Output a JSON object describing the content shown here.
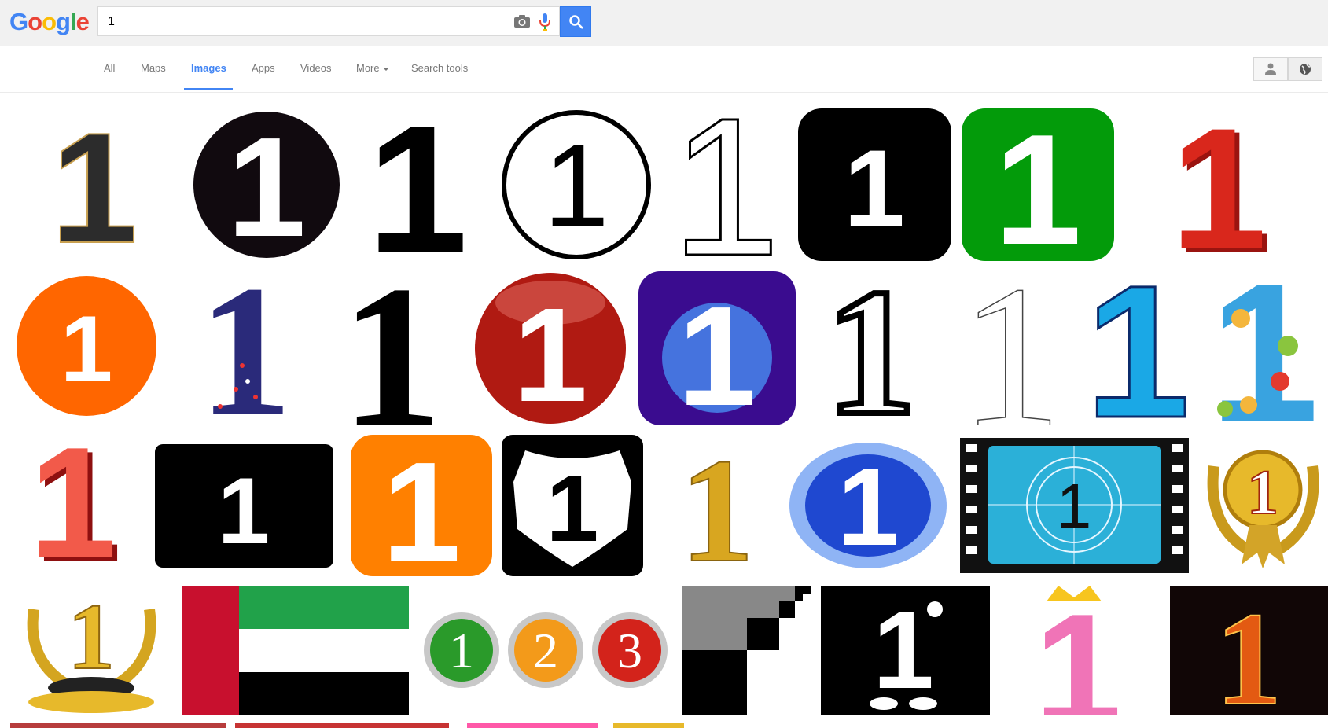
{
  "logo": {
    "letters": [
      "G",
      "o",
      "o",
      "g",
      "l",
      "e"
    ],
    "colors": [
      "#4285f4",
      "#ea4335",
      "#fbbc05",
      "#4285f4",
      "#34a853",
      "#ea4335"
    ]
  },
  "search": {
    "query": "1"
  },
  "tabs": [
    {
      "label": "All",
      "active": false
    },
    {
      "label": "Maps",
      "active": false
    },
    {
      "label": "Images",
      "active": true
    },
    {
      "label": "Apps",
      "active": false
    },
    {
      "label": "Videos",
      "active": false
    },
    {
      "label": "More",
      "active": false
    },
    {
      "label": "Search tools",
      "active": false
    }
  ],
  "colors": {
    "accent": "#4285f4",
    "topbar_bg": "#f1f1f1"
  },
  "results": {
    "rows": [
      [
        "3d-dark-one",
        "black-circle-one",
        "black-one",
        "circled-one",
        "outline-one",
        "black-rounded-square-one",
        "green-rounded-square-one",
        "red-3d-one"
      ],
      [
        "orange-circle-one",
        "starry-one",
        "serif-one",
        "red-glossy-circle-one",
        "purple-glow-square-one",
        "bold-outline-one",
        "thin-outline-one",
        "blue-one",
        "polka-dot-one"
      ],
      [
        "red-3d-one-small",
        "black-rect-one",
        "orange-rounded-square-one",
        "highway-shield-one",
        "gold-one",
        "blue-blur-one",
        "film-countdown-one",
        "gold-laurel-one"
      ],
      [
        "gold-trophy-one",
        "uae-flag",
        "one-two-three-balls",
        "checker-pattern",
        "cartoon-one",
        "pink-crown-one",
        "fire-one"
      ]
    ],
    "badge_digits": [
      "1",
      "2",
      "3"
    ]
  }
}
